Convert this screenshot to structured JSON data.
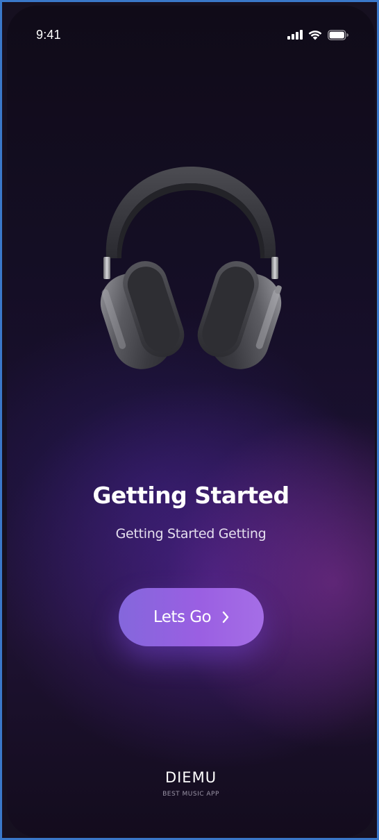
{
  "status_bar": {
    "time": "9:41",
    "icons": [
      "cellular-signal-icon",
      "wifi-icon",
      "battery-icon"
    ]
  },
  "hero": {
    "icon": "headphones-illustration"
  },
  "onboarding": {
    "title": "Getting Started",
    "subtitle": "Getting Started Getting",
    "cta_label": "Lets Go",
    "cta_icon": "chevron-right-icon"
  },
  "brand": {
    "name": "DIEMU",
    "tagline": "BEST MUSIC APP"
  },
  "colors": {
    "background": "#140e24",
    "accent_start": "#8467dc",
    "accent_end": "#a56ee6",
    "text_primary": "#ffffff"
  }
}
